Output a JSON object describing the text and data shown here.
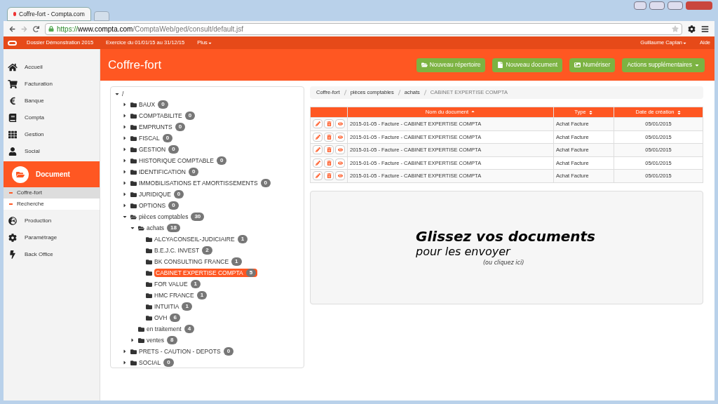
{
  "browser": {
    "tab_title": "Coffre-fort - Compta.com",
    "url_scheme": "https://",
    "url_host": "www.compta.com",
    "url_path": "/ComptaWeb/ged/consult/default.jsf"
  },
  "topnav": {
    "items": [
      "Dossier Démonstration 2015",
      "Exercice du 01/01/15 au 31/12/15"
    ],
    "more": "Plus",
    "user": "Guillaume Caplan",
    "help": "Aide"
  },
  "sidebar": {
    "items": [
      {
        "label": "Accueil",
        "kind": "item"
      },
      {
        "label": "Facturation",
        "kind": "item"
      },
      {
        "label": "Banque",
        "kind": "item"
      },
      {
        "label": "Compta",
        "kind": "item"
      },
      {
        "label": "Gestion",
        "kind": "item"
      },
      {
        "label": "Social",
        "kind": "item"
      },
      {
        "label": "Document",
        "kind": "section",
        "children": [
          {
            "label": "Coffre-fort",
            "selected": true
          },
          {
            "label": "Recherche",
            "selected": false
          }
        ]
      },
      {
        "label": "Production",
        "kind": "item"
      },
      {
        "label": "Paramétrage",
        "kind": "item"
      },
      {
        "label": "Back Office",
        "kind": "item"
      }
    ]
  },
  "page_title": "Coffre-fort",
  "actions": [
    {
      "label": "Nouveau répertoire",
      "kind": "folder"
    },
    {
      "label": "Nouveau document",
      "kind": "file"
    },
    {
      "label": "Numériser",
      "kind": "image"
    },
    {
      "label": "Actions supplémentaires",
      "kind": "dropdown"
    }
  ],
  "tree": {
    "root": "/",
    "children": [
      {
        "label": "BAUX",
        "count": "0",
        "kind": "collapsible",
        "expanded": false,
        "selected": false
      },
      {
        "label": "COMPTABILITE",
        "count": "0",
        "kind": "collapsible",
        "expanded": false,
        "selected": false
      },
      {
        "label": "EMPRUNTS",
        "count": "0",
        "kind": "collapsible",
        "expanded": false,
        "selected": false
      },
      {
        "label": "FISCAL",
        "count": "0",
        "kind": "collapsible",
        "expanded": false,
        "selected": false
      },
      {
        "label": "GESTION",
        "count": "0",
        "kind": "collapsible",
        "expanded": false,
        "selected": false
      },
      {
        "label": "HISTORIQUE COMPTABLE",
        "count": "0",
        "kind": "collapsible",
        "expanded": false,
        "selected": false
      },
      {
        "label": "IDENTIFICATION",
        "count": "0",
        "kind": "collapsible",
        "expanded": false,
        "selected": false
      },
      {
        "label": "IMMOBILISATIONS ET AMORTISSEMENTS",
        "count": "0",
        "kind": "collapsible",
        "expanded": false,
        "selected": false
      },
      {
        "label": "JURIDIQUE",
        "count": "0",
        "kind": "collapsible",
        "expanded": false,
        "selected": false
      },
      {
        "label": "OPTIONS",
        "count": "0",
        "kind": "collapsible",
        "expanded": false,
        "selected": false
      },
      {
        "label": "pièces comptables",
        "count": "30",
        "kind": "collapsible",
        "expanded": true,
        "selected": false,
        "children": [
          {
            "label": "achats",
            "count": "18",
            "kind": "collapsible",
            "expanded": true,
            "selected": false,
            "children": [
              {
                "label": "ALCYACONSEIL-JUDICIAIRE",
                "count": "1",
                "kind": "leaf",
                "selected": false
              },
              {
                "label": "B.E.J.C. INVEST",
                "count": "2",
                "kind": "leaf",
                "selected": false
              },
              {
                "label": "BK CONSULTING FRANCE",
                "count": "1",
                "kind": "leaf",
                "selected": false
              },
              {
                "label": "CABINET EXPERTISE COMPTA",
                "count": "5",
                "kind": "leaf",
                "selected": true
              },
              {
                "label": "FOR VALUE",
                "count": "1",
                "kind": "leaf",
                "selected": false
              },
              {
                "label": "HMC FRANCE",
                "count": "1",
                "kind": "leaf",
                "selected": false
              },
              {
                "label": "INTUITIA",
                "count": "1",
                "kind": "leaf",
                "selected": false
              },
              {
                "label": "OVH",
                "count": "6",
                "kind": "leaf",
                "selected": false
              }
            ]
          },
          {
            "label": "en traitement",
            "count": "4",
            "kind": "leaf",
            "selected": false
          },
          {
            "label": "ventes",
            "count": "8",
            "kind": "collapsible",
            "expanded": false,
            "selected": false
          }
        ]
      },
      {
        "label": "PRETS - CAUTION - DEPOTS",
        "count": "0",
        "kind": "collapsible",
        "expanded": false,
        "selected": false
      },
      {
        "label": "SOCIAL",
        "count": "0",
        "kind": "collapsible",
        "expanded": false,
        "selected": false
      }
    ]
  },
  "breadcrumb": [
    "Coffre-fort",
    "pièces comptables",
    "achats",
    "CABINET EXPERTISE COMPTA"
  ],
  "table": {
    "columns": [
      {
        "label": "Nom du document",
        "sorted": true
      },
      {
        "label": "Type",
        "sorted": false
      },
      {
        "label": "Date de création",
        "sorted": false
      }
    ],
    "rows": [
      [
        "2015-01-05 - Facture - CABINET EXPERTISE COMPTA",
        "Achat Facture",
        "05/01/2015"
      ],
      [
        "2015-01-05 - Facture - CABINET EXPERTISE COMPTA",
        "Achat Facture",
        "05/01/2015"
      ],
      [
        "2015-01-05 - Facture - CABINET EXPERTISE COMPTA",
        "Achat Facture",
        "05/01/2015"
      ],
      [
        "2015-01-05 - Facture - CABINET EXPERTISE COMPTA",
        "Achat Facture",
        "05/01/2015"
      ],
      [
        "2015-01-05 - Facture - CABINET EXPERTISE COMPTA",
        "Achat Facture",
        "05/01/2015"
      ]
    ]
  },
  "dropzone": {
    "title": "Glissez vos documents",
    "subtitle": "pour les envoyer",
    "hint": "(ou cliquez ici)"
  }
}
